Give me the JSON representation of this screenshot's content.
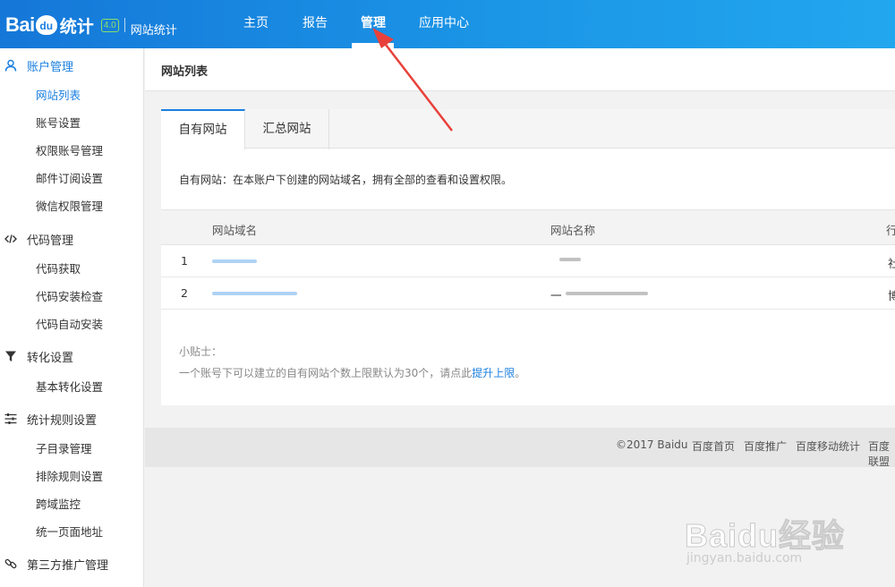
{
  "brand": {
    "logo_bai": "Bai",
    "logo_du": "du",
    "logo_tongji": "统计",
    "version": "4.0",
    "product": "网站统计"
  },
  "nav": {
    "items": [
      {
        "label": "主页"
      },
      {
        "label": "报告"
      },
      {
        "label": "管理"
      },
      {
        "label": "应用中心"
      }
    ]
  },
  "sidebar": {
    "groups": [
      {
        "label": "账户管理",
        "icon": "user-icon",
        "items": [
          "网站列表",
          "账号设置",
          "权限账号管理",
          "邮件订阅设置",
          "微信权限管理"
        ]
      },
      {
        "label": "代码管理",
        "icon": "code-icon",
        "items": [
          "代码获取",
          "代码安装检查",
          "代码自动安装"
        ]
      },
      {
        "label": "转化设置",
        "icon": "filter-icon",
        "items": [
          "基本转化设置"
        ]
      },
      {
        "label": "统计规则设置",
        "icon": "sliders-icon",
        "items": [
          "子目录管理",
          "排除规则设置",
          "跨域监控",
          "统一页面地址"
        ]
      },
      {
        "label": "第三方推广管理",
        "icon": "link-icon",
        "items": []
      }
    ]
  },
  "page": {
    "title": "网站列表",
    "tabs": [
      "自有网站",
      "汇总网站"
    ],
    "description": "自有网站：在本账户下创建的网站域名，拥有全部的查看和设置权限。",
    "table": {
      "headers": [
        "网站域名",
        "网站名称",
        "行"
      ],
      "rows": [
        {
          "index": "1",
          "domain": "",
          "name": "",
          "extra": "社"
        },
        {
          "index": "2",
          "domain": "",
          "name": "一",
          "extra": "博"
        }
      ]
    },
    "tips_title": "小贴士：",
    "tips_text": "一个账号下可以建立的自有网站个数上限默认为30个，请点此",
    "tips_link": "提升上限",
    "tips_end": "。"
  },
  "footer": {
    "copyright": "©2017 Baidu",
    "links": [
      "百度首页",
      "百度推广",
      "百度移动统计",
      "百度联盟"
    ]
  },
  "watermark": {
    "main": "Baidu经验",
    "sub": "jingyan.baidu.com"
  },
  "colors": {
    "header_start": "#1577d8",
    "header_end": "#22a7ee",
    "accent": "#1a7fe0",
    "annotation": "#e8413b"
  }
}
